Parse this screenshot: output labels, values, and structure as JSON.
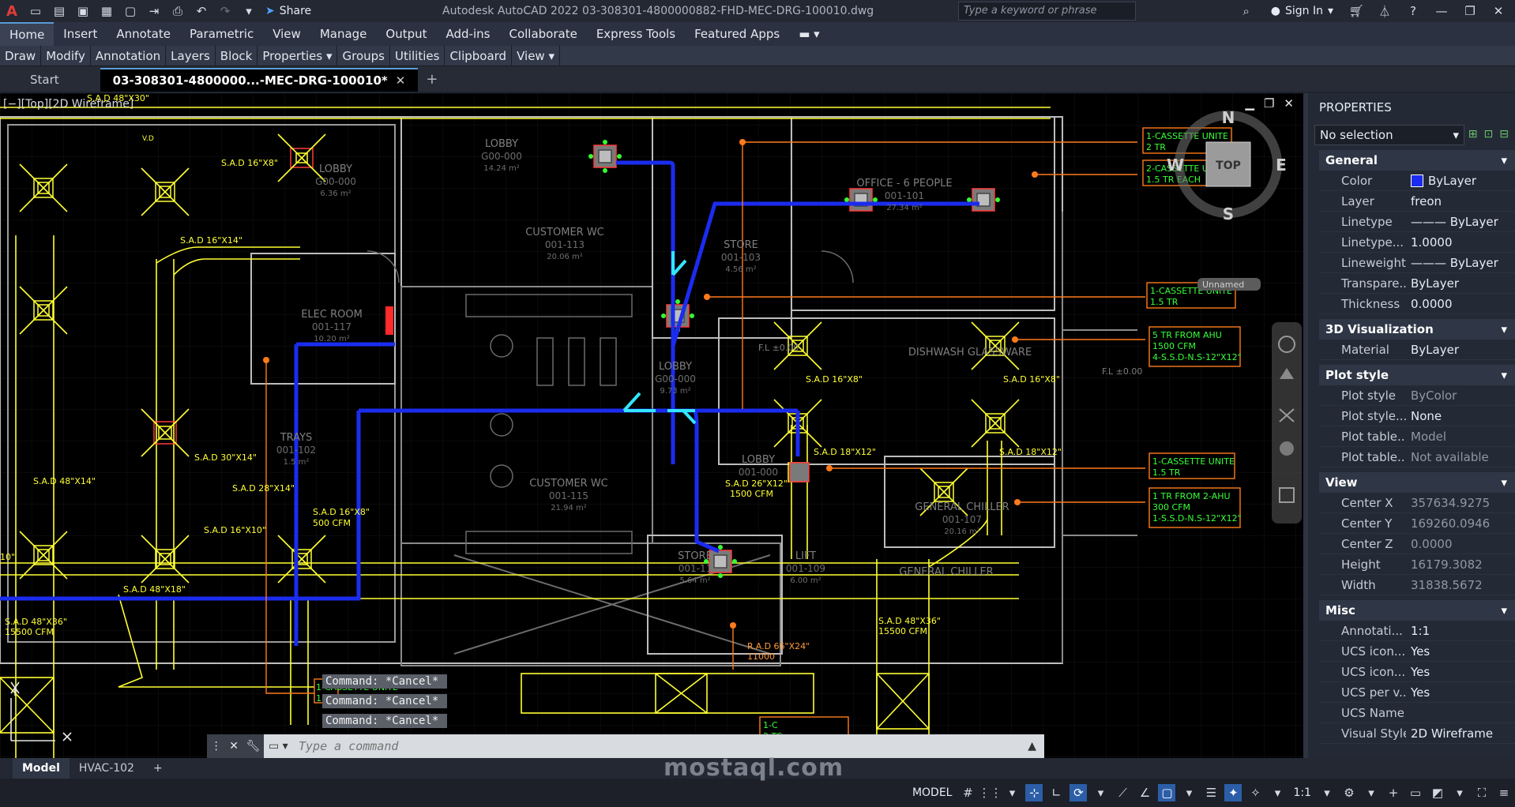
{
  "app": {
    "logo": "A",
    "share_label": "Share",
    "title": "Autodesk AutoCAD 2022   03-308301-4800000882-FHD-MEC-DRG-100010.dwg",
    "search_placeholder": "Type a keyword or phrase",
    "signin_label": "Sign In"
  },
  "ribbon": {
    "tabs": [
      "Home",
      "Insert",
      "Annotate",
      "Parametric",
      "View",
      "Manage",
      "Output",
      "Add-ins",
      "Collaborate",
      "Express Tools",
      "Featured Apps"
    ],
    "panels": [
      "Draw",
      "Modify",
      "Annotation",
      "Layers",
      "Block",
      "Properties ▾",
      "Groups",
      "Utilities",
      "Clipboard",
      "View ▾"
    ]
  },
  "doc_tabs": {
    "start": "Start",
    "active": "03-308301-4800000...-MEC-DRG-100010*"
  },
  "viewport": {
    "label": "[−][Top][2D Wireframe]",
    "viewcube": {
      "top": "TOP",
      "n": "N",
      "s": "S",
      "e": "E",
      "w": "W",
      "unnamed": "Unnamed"
    }
  },
  "drawing": {
    "rooms": [
      {
        "name": "LOBBY",
        "code": "G00-000",
        "area": "14.24 m²"
      },
      {
        "name": "LOBBY",
        "code": "G00-000",
        "area": "6.36 m²"
      },
      {
        "name": "OFFICE - 6 PEOPLE",
        "code": "001-101",
        "area": "27.34 m²"
      },
      {
        "name": "CUSTOMER WC",
        "code": "001-113",
        "area": "20.06 m²"
      },
      {
        "name": "STORE",
        "code": "001-103",
        "area": "4.56 m²"
      },
      {
        "name": "ELEC ROOM",
        "code": "001-117",
        "area": "10.20 m²"
      },
      {
        "name": "LOBBY",
        "code": "G00-000",
        "area": "9.73 m²"
      },
      {
        "name": "TRAYS",
        "code": "001-102",
        "area": "1.5 m²"
      },
      {
        "name": "LOBBY",
        "code": "001-000",
        "area": ""
      },
      {
        "name": "CUSTOMER WC",
        "code": "001-115",
        "area": "21.94 m²"
      },
      {
        "name": "STORE",
        "code": "001-11",
        "area": "5.64 m²"
      },
      {
        "name": "LIFT",
        "code": "001-109",
        "area": "6.00 m²"
      },
      {
        "name": "DISHWASH GLASSWARE",
        "code": "",
        "area": ""
      },
      {
        "name": "GENERAL CHILLER",
        "code": "001-107",
        "area": "20.16 m²"
      },
      {
        "name": "GENERAL CHILLER",
        "code": "",
        "area": ""
      }
    ],
    "duct_labels": [
      "S.A.D 48\"X30\"",
      "S.A.D 16\"X8\"",
      "S.A.D 16\"X14\"",
      "S.A.D 30\"X14\"",
      "S.A.D 48\"X14\"",
      "S.A.D 28\"X14\"",
      "S.A.D 16\"X8\"",
      "500 CFM",
      "S.A.D 16\"X10\"",
      "S.A.D 48\"X18\"",
      "S.A.D 48\"X36\"",
      "15500 CFM",
      "S.A.D 16\"X8\"",
      "S.A.D 18\"X12\"",
      "S.A.D 26\"X12\"",
      "1500 CFM",
      "S.A.D 16\"X8\"",
      "S.A.D 18\"X12\"",
      "S.A.D 48\"X36\"",
      "15500 CFM",
      "R.A.D 66\"X24\"",
      "11000",
      "10\"",
      "V.D",
      "F.L ±0.00",
      "F.L ±0.00"
    ],
    "callouts": [
      [
        "1-CASSETTE UNITE",
        "2 TR"
      ],
      [
        "2-CASSETTE UNITE",
        "1.5 TR  EACH"
      ],
      [
        "1-CASSETTE UNITE",
        "1.5 TR"
      ],
      [
        "5 TR FROM AHU",
        "1500 CFM",
        "4-S.S.D-N.S-12\"X12\""
      ],
      [
        "1-CASSETTE UNITE",
        "1.5 TR"
      ],
      [
        "1 TR FROM 2-AHU",
        "300 CFM",
        "1-S.S.D-N.S-12\"X12\""
      ],
      [
        "1-CASSETTE UNITE",
        "1.5 TR"
      ],
      [
        "1-C",
        "2 TC"
      ]
    ]
  },
  "command": {
    "history": [
      "Command: *Cancel*",
      "Command: *Cancel*",
      "Command: *Cancel*"
    ],
    "placeholder": "Type a command"
  },
  "properties": {
    "title": "PROPERTIES",
    "selection": "No selection",
    "groups": [
      {
        "name": "General",
        "rows": [
          {
            "k": "Color",
            "v": "ByLayer",
            "swatch": true
          },
          {
            "k": "Layer",
            "v": "freon"
          },
          {
            "k": "Linetype",
            "v": "——— ByLayer"
          },
          {
            "k": "Linetype...",
            "v": "1.0000"
          },
          {
            "k": "Lineweight",
            "v": "——— ByLayer"
          },
          {
            "k": "Transpare...",
            "v": "ByLayer"
          },
          {
            "k": "Thickness",
            "v": "0.0000"
          }
        ]
      },
      {
        "name": "3D Visualization",
        "rows": [
          {
            "k": "Material",
            "v": "ByLayer"
          }
        ]
      },
      {
        "name": "Plot style",
        "rows": [
          {
            "k": "Plot style",
            "v": "ByColor",
            "dim": true
          },
          {
            "k": "Plot style...",
            "v": "None"
          },
          {
            "k": "Plot table...",
            "v": "Model",
            "dim": true
          },
          {
            "k": "Plot table...",
            "v": "Not available",
            "dim": true
          }
        ]
      },
      {
        "name": "View",
        "rows": [
          {
            "k": "Center X",
            "v": "357634.9275",
            "dim": true
          },
          {
            "k": "Center Y",
            "v": "169260.0946",
            "dim": true
          },
          {
            "k": "Center Z",
            "v": "0.0000",
            "dim": true
          },
          {
            "k": "Height",
            "v": "16179.3082",
            "dim": true
          },
          {
            "k": "Width",
            "v": "31838.5672",
            "dim": true
          }
        ]
      },
      {
        "name": "Misc",
        "rows": [
          {
            "k": "Annotati...",
            "v": "1:1"
          },
          {
            "k": "UCS icon...",
            "v": "Yes"
          },
          {
            "k": "UCS icon...",
            "v": "Yes"
          },
          {
            "k": "UCS per v...",
            "v": "Yes"
          },
          {
            "k": "UCS Name",
            "v": ""
          },
          {
            "k": "Visual Style",
            "v": "2D Wireframe"
          }
        ]
      }
    ]
  },
  "layout_tabs": [
    "Model",
    "HVAC-102"
  ],
  "status": {
    "model_label": "MODEL",
    "scale": "1:1"
  },
  "watermark": "mostaql.com",
  "colors": {
    "duct": "#ffff33",
    "freon": "#1b2cf0",
    "callout": "#ff7a1a",
    "callout_text": "#39ff39",
    "wall": "#cfcfcf",
    "accent": "#5b9bd5"
  }
}
